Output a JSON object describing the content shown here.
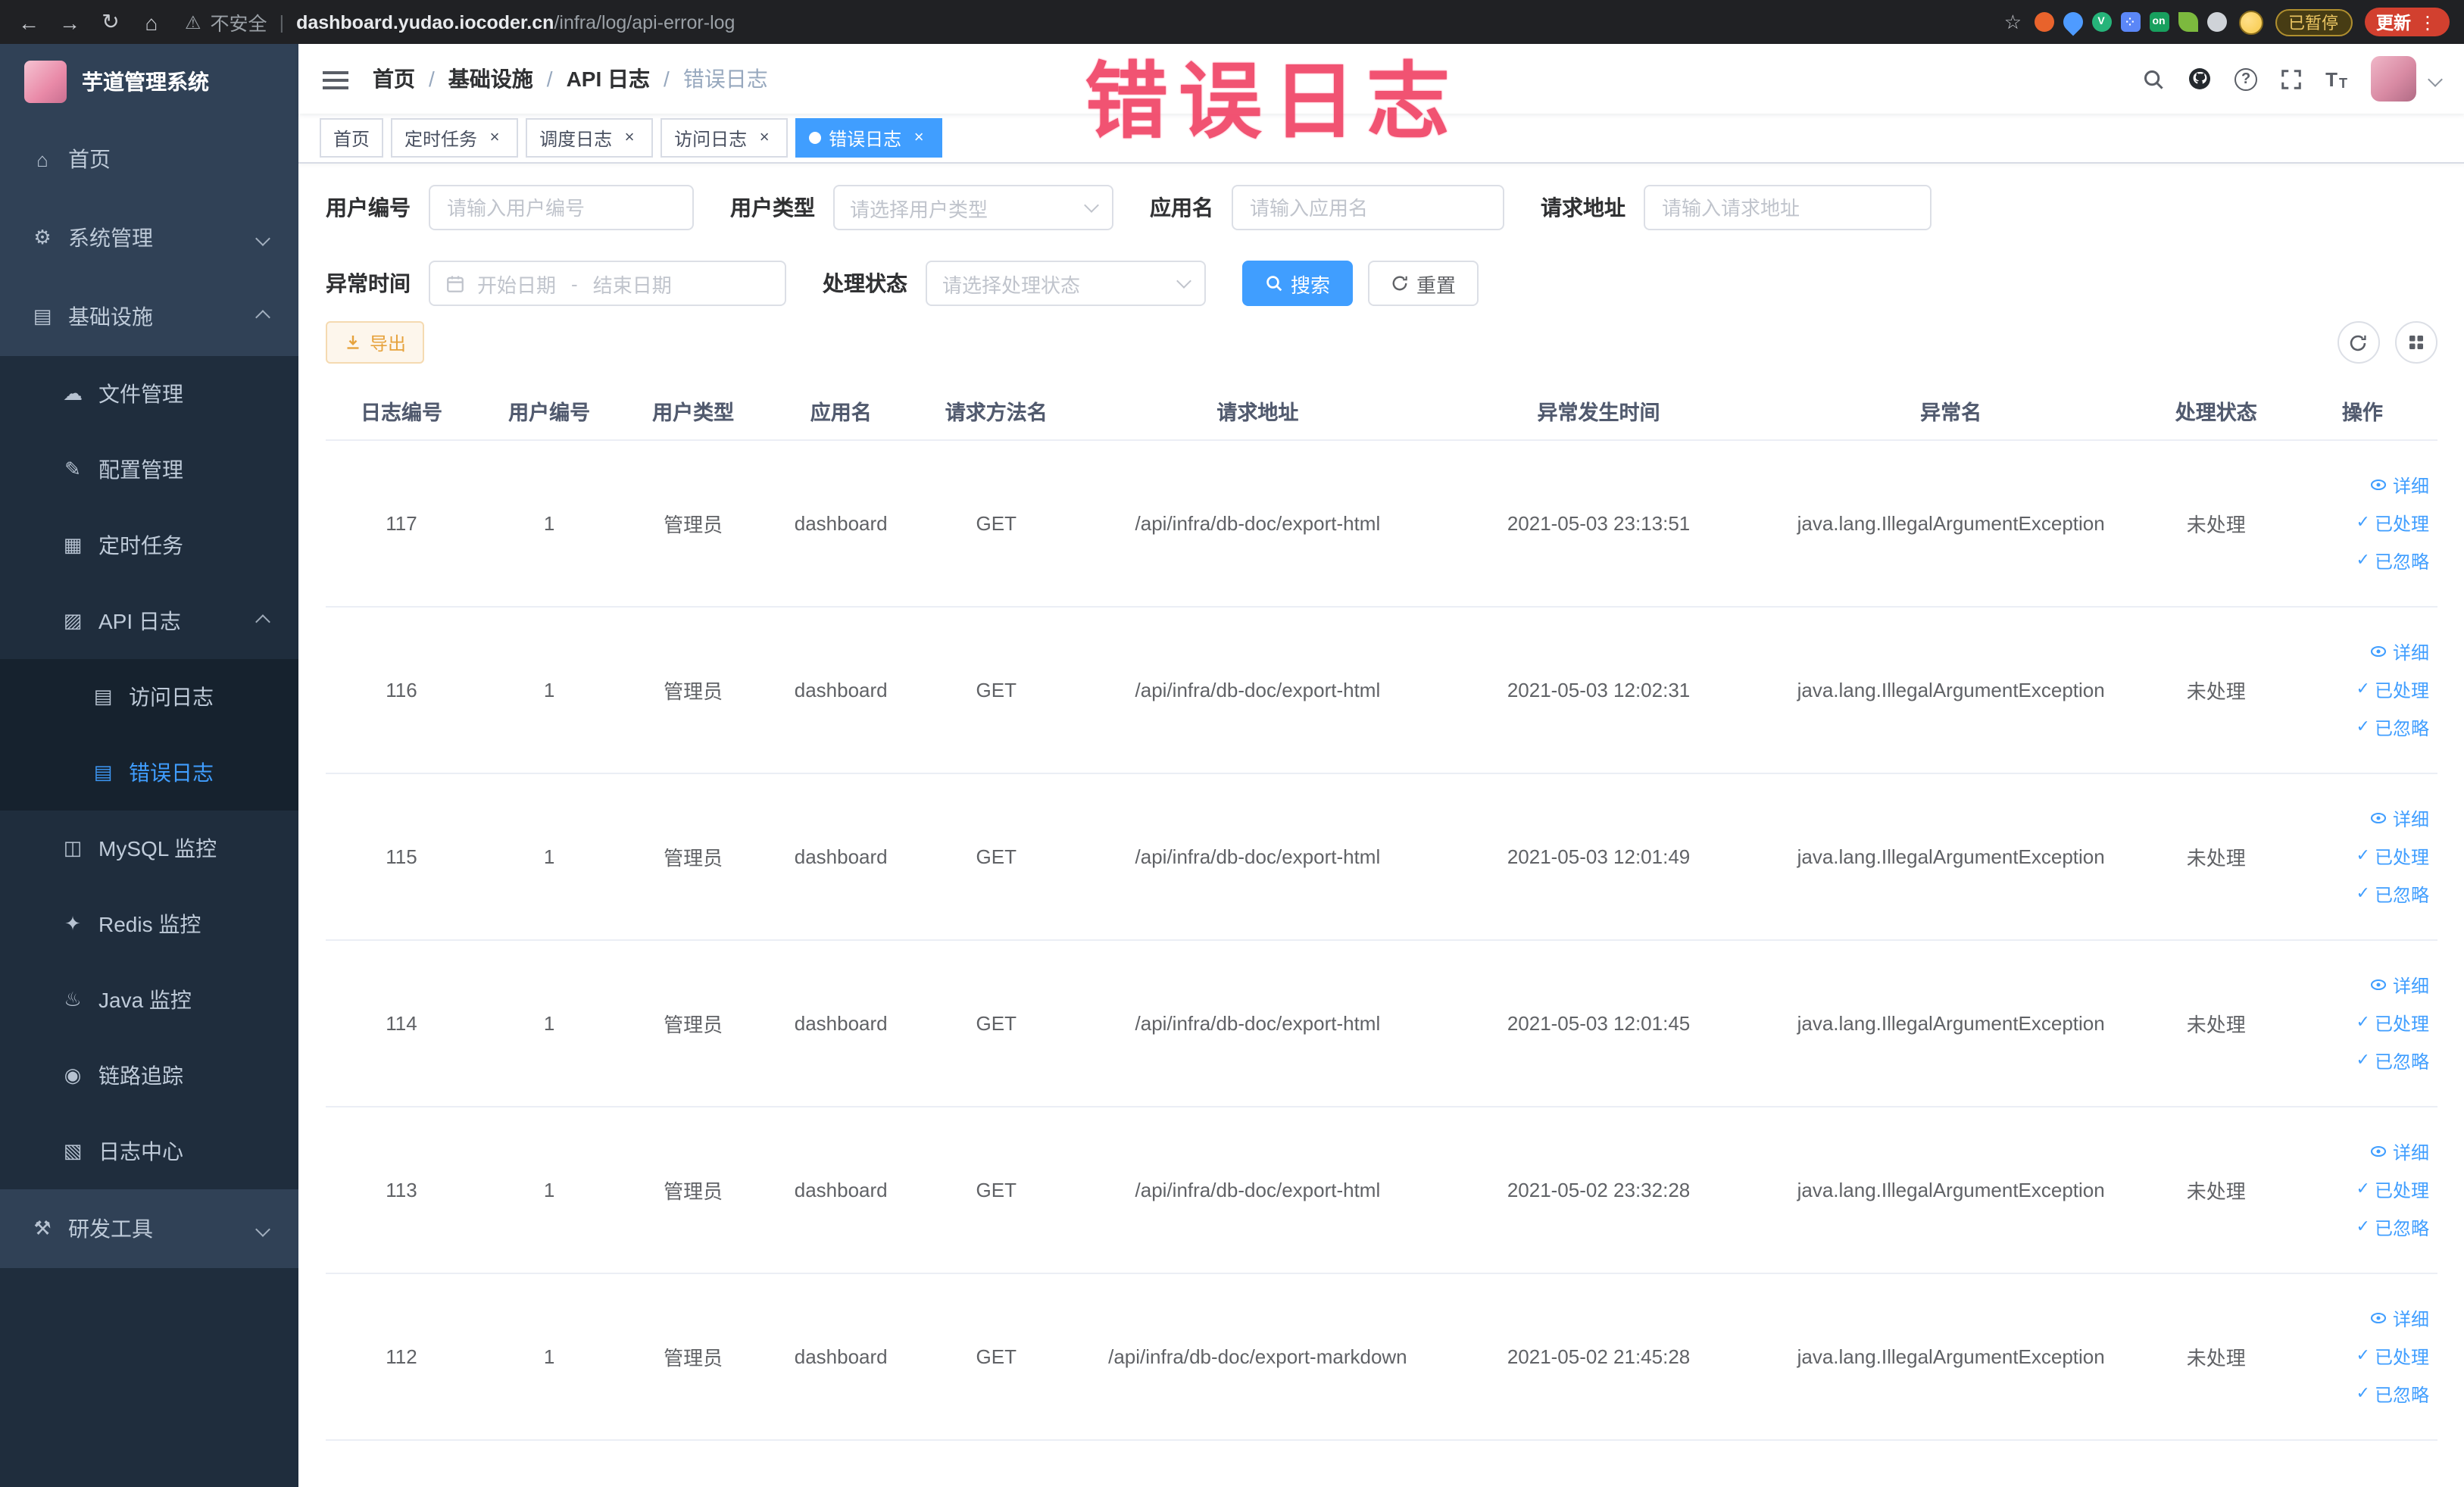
{
  "colors": {
    "accent": "#409eff",
    "sidebar_bg": "#304156",
    "submenu_bg": "#1f2d3d",
    "submenu_nested_bg": "#16222e",
    "warning": "#e6a23c",
    "annotation": "#f14668",
    "active_tag_bg": "#409eff"
  },
  "browser": {
    "security_label": "不安全",
    "url_host": "dashboard.yudao.iocoder.cn",
    "url_path": "/infra/log/api-error-log",
    "paused_badge": "已暂停",
    "update_button": "更新",
    "kebab": "⋮",
    "extensions": [
      {
        "shape": "circle",
        "color": "#e8632c",
        "glyph": ""
      },
      {
        "shape": "drop",
        "color": "#4e9bff",
        "glyph": ""
      },
      {
        "shape": "circle",
        "color": "#26b47a",
        "glyph": "V"
      },
      {
        "shape": "square",
        "color": "#5b87f7",
        "glyph": "⁘"
      },
      {
        "shape": "square",
        "color": "#18a05e",
        "glyph": "on"
      },
      {
        "shape": "leaf",
        "color": "#7cb93e",
        "glyph": ""
      },
      {
        "shape": "circle",
        "color": "#cfd3d8",
        "glyph": ""
      }
    ]
  },
  "annotation": {
    "text": "错误日志"
  },
  "sidebar": {
    "logo_title": "芋道管理系统",
    "items": [
      {
        "key": "home",
        "label": "首页",
        "level": 1,
        "icon": "home-icon",
        "chevron": null,
        "active": false
      },
      {
        "key": "system",
        "label": "系统管理",
        "level": 1,
        "icon": "gear-icon",
        "chevron": "down",
        "active": false
      },
      {
        "key": "infra",
        "label": "基础设施",
        "level": 1,
        "icon": "infra-icon",
        "chevron": "up",
        "active": false
      },
      {
        "key": "file",
        "label": "文件管理",
        "level": 2,
        "icon": "file-icon",
        "chevron": null,
        "active": false
      },
      {
        "key": "config",
        "label": "配置管理",
        "level": 2,
        "icon": "config-icon",
        "chevron": null,
        "active": false
      },
      {
        "key": "job",
        "label": "定时任务",
        "level": 2,
        "icon": "job-icon",
        "chevron": null,
        "active": false
      },
      {
        "key": "api-log",
        "label": "API 日志",
        "level": 2,
        "icon": "api-log-icon",
        "chevron": "up",
        "active": false
      },
      {
        "key": "access-log",
        "label": "访问日志",
        "level": 3,
        "icon": "access-log-icon",
        "chevron": null,
        "active": false
      },
      {
        "key": "error-log",
        "label": "错误日志",
        "level": 3,
        "icon": "error-log-icon",
        "chevron": null,
        "active": true
      },
      {
        "key": "mysql",
        "label": "MySQL 监控",
        "level": 2,
        "icon": "mysql-icon",
        "chevron": null,
        "active": false
      },
      {
        "key": "redis",
        "label": "Redis 监控",
        "level": 2,
        "icon": "redis-icon",
        "chevron": null,
        "active": false
      },
      {
        "key": "java",
        "label": "Java 监控",
        "level": 2,
        "icon": "java-icon",
        "chevron": null,
        "active": false
      },
      {
        "key": "trace",
        "label": "链路追踪",
        "level": 2,
        "icon": "trace-icon",
        "chevron": null,
        "active": false
      },
      {
        "key": "log-center",
        "label": "日志中心",
        "level": 2,
        "icon": "log-center-icon",
        "chevron": null,
        "active": false
      },
      {
        "key": "dev-tools",
        "label": "研发工具",
        "level": 1,
        "icon": "tool-icon",
        "chevron": "down",
        "active": false
      }
    ]
  },
  "breadcrumb": [
    "首页",
    "基础设施",
    "API 日志",
    "错误日志"
  ],
  "tags": [
    {
      "label": "首页",
      "active": false,
      "closable": false
    },
    {
      "label": "定时任务",
      "active": false,
      "closable": true
    },
    {
      "label": "调度日志",
      "active": false,
      "closable": true
    },
    {
      "label": "访问日志",
      "active": false,
      "closable": true
    },
    {
      "label": "错误日志",
      "active": true,
      "closable": true
    }
  ],
  "filters": {
    "user_id": {
      "label": "用户编号",
      "placeholder": "请输入用户编号"
    },
    "user_type": {
      "label": "用户类型",
      "placeholder": "请选择用户类型"
    },
    "app_name": {
      "label": "应用名",
      "placeholder": "请输入应用名"
    },
    "request_url": {
      "label": "请求地址",
      "placeholder": "请输入请求地址"
    },
    "exception_time": {
      "label": "异常时间",
      "start_placeholder": "开始日期",
      "separator": "-",
      "end_placeholder": "结束日期"
    },
    "process_status": {
      "label": "处理状态",
      "placeholder": "请选择处理状态"
    },
    "search_button": "搜索",
    "reset_button": "重置"
  },
  "toolbar": {
    "export_button": "导出"
  },
  "table": {
    "columns": [
      "日志编号",
      "用户编号",
      "用户类型",
      "应用名",
      "请求方法名",
      "请求地址",
      "异常发生时间",
      "异常名",
      "处理状态",
      "操作"
    ],
    "actions": {
      "detail": "详细",
      "processed": "已处理",
      "ignore": "已忽略"
    },
    "rows": [
      {
        "id": "117",
        "user_id": "1",
        "user_type": "管理员",
        "app": "dashboard",
        "method": "GET",
        "url": "/api/infra/db-doc/export-html",
        "time": "2021-05-03 23:13:51",
        "exception": "java.lang.IllegalArgumentException",
        "status": "未处理"
      },
      {
        "id": "116",
        "user_id": "1",
        "user_type": "管理员",
        "app": "dashboard",
        "method": "GET",
        "url": "/api/infra/db-doc/export-html",
        "time": "2021-05-03 12:02:31",
        "exception": "java.lang.IllegalArgumentException",
        "status": "未处理"
      },
      {
        "id": "115",
        "user_id": "1",
        "user_type": "管理员",
        "app": "dashboard",
        "method": "GET",
        "url": "/api/infra/db-doc/export-html",
        "time": "2021-05-03 12:01:49",
        "exception": "java.lang.IllegalArgumentException",
        "status": "未处理"
      },
      {
        "id": "114",
        "user_id": "1",
        "user_type": "管理员",
        "app": "dashboard",
        "method": "GET",
        "url": "/api/infra/db-doc/export-html",
        "time": "2021-05-03 12:01:45",
        "exception": "java.lang.IllegalArgumentException",
        "status": "未处理"
      },
      {
        "id": "113",
        "user_id": "1",
        "user_type": "管理员",
        "app": "dashboard",
        "method": "GET",
        "url": "/api/infra/db-doc/export-html",
        "time": "2021-05-02 23:32:28",
        "exception": "java.lang.IllegalArgumentException",
        "status": "未处理"
      },
      {
        "id": "112",
        "user_id": "1",
        "user_type": "管理员",
        "app": "dashboard",
        "method": "GET",
        "url": "/api/infra/db-doc/export-markdown",
        "time": "2021-05-02 21:45:28",
        "exception": "java.lang.IllegalArgumentException",
        "status": "未处理"
      }
    ]
  }
}
